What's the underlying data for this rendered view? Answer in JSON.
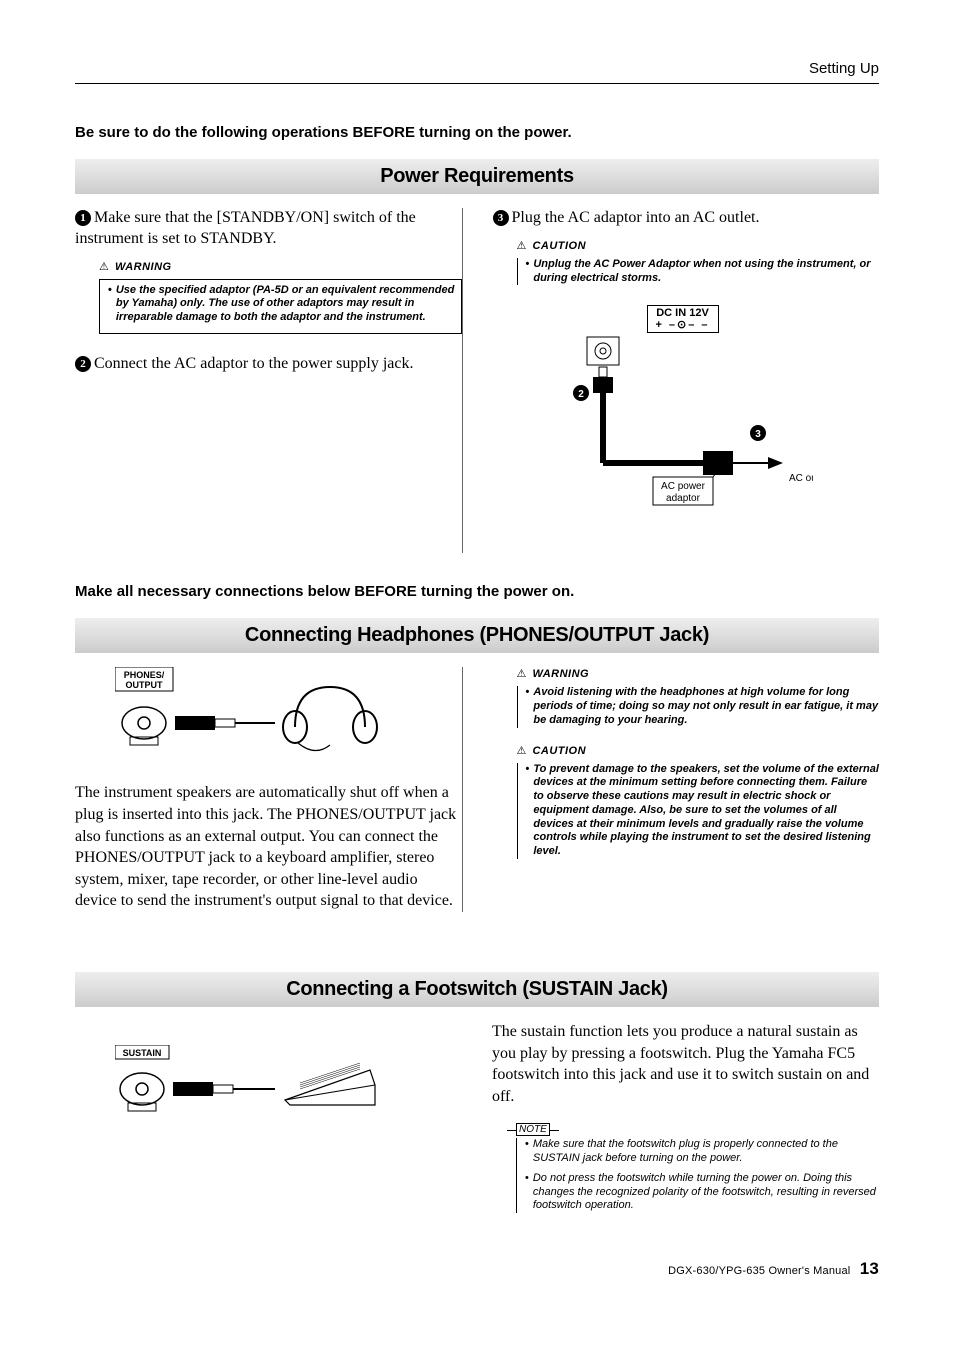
{
  "header": {
    "section": "Setting Up"
  },
  "intro1": "Be sure to do the following operations BEFORE turning on the power.",
  "section_power": "Power Requirements",
  "power": {
    "step1": "Make sure that the [STANDBY/ON] switch of the instrument is set to STANDBY.",
    "warn1_title": "WARNING",
    "warn1_body": "Use the specified adaptor (PA-5D or an equivalent recommended by Yamaha) only. The use of other adaptors may result in irreparable damage to both the adaptor and the instrument.",
    "step2": "Connect the AC adaptor to the power supply jack.",
    "step3": "Plug the AC adaptor into an AC outlet.",
    "caution1_title": "CAUTION",
    "caution1_body": "Unplug the AC Power Adaptor when not using the instrument, or during electrical storms.",
    "dcin_top": "DC IN 12V",
    "dcin_bottom": "+ –⊙– –",
    "ac_adaptor": "AC power adaptor",
    "ac_outlet": "AC outlet"
  },
  "intro2": "Make all necessary connections below BEFORE turning the power on.",
  "section_phones": "Connecting Headphones (PHONES/OUTPUT Jack)",
  "phones": {
    "label_top": "PHONES/",
    "label_bottom": "OUTPUT",
    "body": "The instrument speakers are automatically shut off when a plug is inserted into this jack. The PHONES/OUTPUT jack also functions as an external output. You can connect the PHONES/OUTPUT jack to a keyboard amplifier, stereo system, mixer, tape recorder, or other line-level audio device to send the instrument's output signal to that device.",
    "warn_title": "WARNING",
    "warn_body": "Avoid listening with the headphones at high volume for long periods of time; doing so may not only result in ear fatigue, it may be damaging to your hearing.",
    "caution_title": "CAUTION",
    "caution_body": "To prevent damage to the speakers, set the volume of the external devices at the minimum setting before connecting them. Failure to observe these cautions may result in electric shock or equipment damage. Also, be sure to set the volumes of all devices at their minimum levels and gradually raise the volume controls while playing the instrument to set the desired listening level."
  },
  "section_sustain": "Connecting a Footswitch (SUSTAIN Jack)",
  "sustain": {
    "label": "SUSTAIN",
    "body": "The sustain function lets you produce a natural sustain as you play by pressing a footswitch. Plug the Yamaha FC5 footswitch into this jack and use it to switch sustain on and off.",
    "note_title": "NOTE",
    "note1": "Make sure that the footswitch plug is properly connected to the SUSTAIN jack before turning on the power.",
    "note2": "Do not press the footswitch while turning the power on. Doing this changes the recognized polarity of the footswitch, resulting in reversed footswitch operation."
  },
  "footer": {
    "text": "DGX-630/YPG-635  Owner's Manual",
    "page": "13"
  }
}
